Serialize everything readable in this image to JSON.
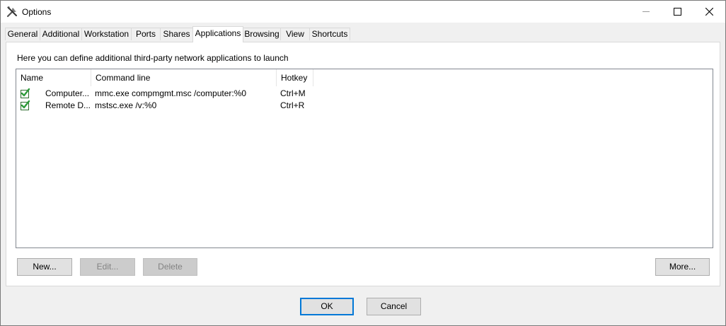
{
  "window": {
    "title": "Options",
    "minimize_icon": "minimize-icon",
    "maximize_icon": "maximize-icon",
    "close_icon": "close-icon"
  },
  "tabs": [
    {
      "label": "General"
    },
    {
      "label": "Additional"
    },
    {
      "label": "Workstation"
    },
    {
      "label": "Ports"
    },
    {
      "label": "Shares"
    },
    {
      "label": "Applications",
      "active": true
    },
    {
      "label": "Browsing"
    },
    {
      "label": "View"
    },
    {
      "label": "Shortcuts"
    }
  ],
  "panel": {
    "description": "Here you can define additional third-party network applications to launch",
    "columns": [
      "Name",
      "Command line",
      "Hotkey"
    ],
    "rows": [
      {
        "checked": true,
        "name": "Computer...",
        "command": "mmc.exe compmgmt.msc /computer:%0",
        "hotkey": "Ctrl+M"
      },
      {
        "checked": true,
        "name": "Remote D...",
        "command": "mstsc.exe /v:%0",
        "hotkey": "Ctrl+R"
      }
    ],
    "buttons": {
      "new": "New...",
      "edit": "Edit...",
      "delete": "Delete",
      "more": "More..."
    }
  },
  "footer": {
    "ok": "OK",
    "cancel": "Cancel"
  },
  "colors": {
    "check_green": "#2e9b3a",
    "default_button_border": "#0078d7"
  }
}
